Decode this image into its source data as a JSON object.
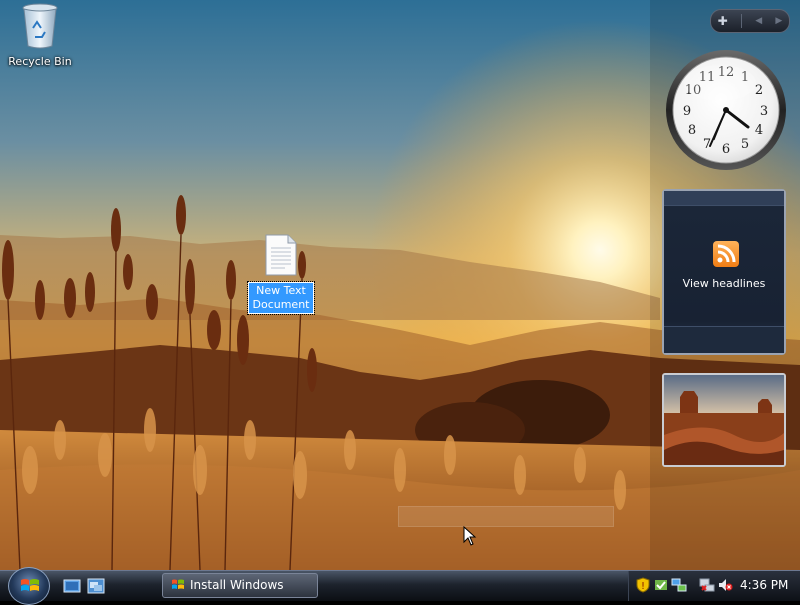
{
  "desktop": {
    "icons": [
      {
        "label": "Recycle Bin"
      },
      {
        "label": "New Text Document"
      }
    ]
  },
  "gadgets": {
    "clock": {
      "time_shown": "4:36"
    },
    "feed": {
      "label": "View headlines"
    }
  },
  "taskbar": {
    "buttons": [
      {
        "label": "Install Windows"
      }
    ],
    "tray": {
      "time": "4:36 PM",
      "icons": [
        "windows-security-icon",
        "update-icon",
        "network-icon",
        "network-disconnected-icon",
        "volume-muted-icon"
      ]
    }
  },
  "colors": {
    "selection": "#3399ff",
    "feed_accent": "#f07d14",
    "taskbar": "#1d232d"
  }
}
